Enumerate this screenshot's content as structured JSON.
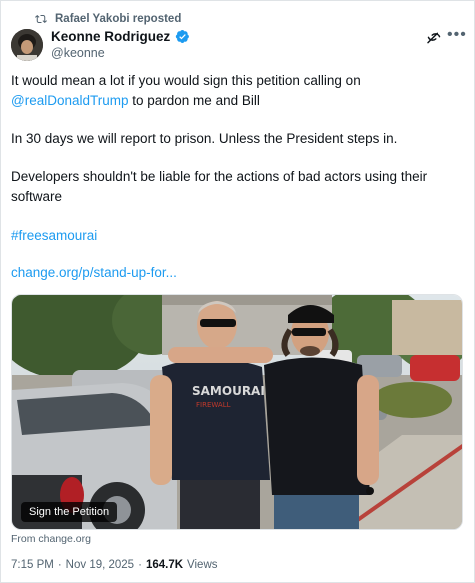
{
  "repost": {
    "text": "Rafael Yakobi reposted",
    "icon": "repost-icon"
  },
  "author": {
    "display_name": "Keonne Rodriguez",
    "handle": "@keonne",
    "verified": true,
    "badge_color": "#1d9bf0"
  },
  "tweet": {
    "line1a": "It would mean a lot if you would sign this petition calling on",
    "mention": "@realDonaldTrump",
    "line1b": "to pardon me and Bill",
    "para2": "In 30 days we will report to prison. Unless the President steps in.",
    "para3": "Developers shouldn't be liable for the actions of bad actors using their software",
    "hashtag": "#freesamourai",
    "url": "change.org/p/stand-up-for..."
  },
  "media": {
    "overlay_label": "Sign the Petition",
    "shirt_text_a": "SAMOURAI",
    "shirt_text_b": "FIREWALL"
  },
  "link_source": "From change.org",
  "meta": {
    "time": "7:15 PM",
    "separator": "·",
    "date": "Nov 19, 2025",
    "views_count": "164.7K",
    "views_label": "Views"
  },
  "colors": {
    "accent": "#1d9bf0",
    "secondary_text": "#536471",
    "primary_text": "#0f1419"
  }
}
